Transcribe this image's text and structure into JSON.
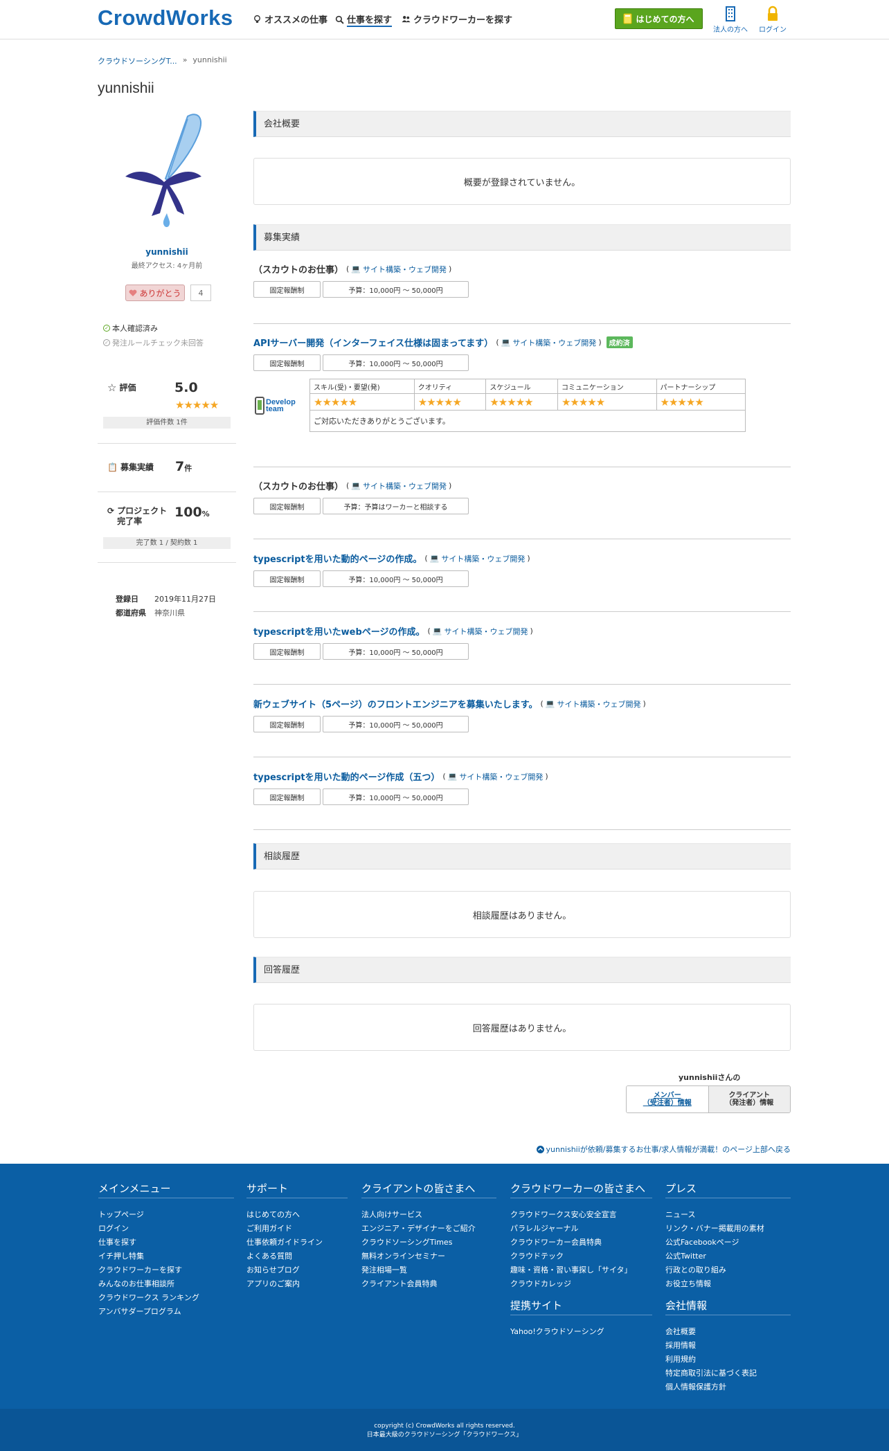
{
  "header": {
    "logo": "CrowdWorks",
    "nav": [
      {
        "label": "オススメの仕事"
      },
      {
        "label": "仕事を探す"
      },
      {
        "label": "クラウドワーカーを探す"
      }
    ],
    "start_button": "はじめての方へ",
    "corporate_label": "法人の方へ",
    "login_label": "ログイン"
  },
  "breadcrumb": {
    "root": "クラウドソーシングT...",
    "separator": "»",
    "current": "yunnishii"
  },
  "page_title": "yunnishii",
  "profile": {
    "name": "yunnishii",
    "last_access": "最終アクセス: 4ヶ月前",
    "thanks_label": "ありがとう",
    "thanks_count": "4",
    "verified": "本人確認済み",
    "rule_check": "発注ルールチェック未回答",
    "rating_label": "評価",
    "rating_value": "5.0",
    "rating_stars": "★★★★★",
    "rating_count": "評価件数 1件",
    "recruit_label": "募集実績",
    "recruit_value": "7",
    "recruit_unit": "件",
    "completion_label_1": "プロジェクト",
    "completion_label_2": "完了率",
    "completion_value": "100",
    "completion_unit": "%",
    "completion_sub": "完了数 1 / 契約数 1",
    "registered_label": "登録日",
    "registered_value": "2019年11月27日",
    "prefecture_label": "都道府県",
    "prefecture_value": "神奈川県"
  },
  "sections": {
    "overview": "会社概要",
    "overview_empty": "概要が登録されていません。",
    "recruit": "募集実績",
    "consult": "相談履歴",
    "consult_empty": "相談履歴はありません。",
    "answer": "回答履歴",
    "answer_empty": "回答履歴はありません。"
  },
  "jobs": [
    {
      "title": "（スカウトのお仕事）",
      "category": "サイト構築・ウェブ開発",
      "type": "固定報酬制",
      "budget": "予算：10,000円 〜 50,000円"
    },
    {
      "title": "APIサーバー開発（インターフェイス仕様は固まってます）",
      "category": "サイト構築・ウェブ開発",
      "badge": "成約済",
      "type": "固定報酬制",
      "budget": "予算：10,000円 〜 50,000円"
    },
    {
      "title": "（スカウトのお仕事）",
      "category": "サイト構築・ウェブ開発",
      "type": "固定報酬制",
      "budget": "予算：予算はワーカーと相談する"
    },
    {
      "title": "typescriptを用いた動的ページの作成。",
      "category": "サイト構築・ウェブ開発",
      "type": "固定報酬制",
      "budget": "予算：10,000円 〜 50,000円"
    },
    {
      "title": "typescriptを用いたwebページの作成。",
      "category": "サイト構築・ウェブ開発",
      "type": "固定報酬制",
      "budget": "予算：10,000円 〜 50,000円"
    },
    {
      "title": "新ウェブサイト（5ページ）のフロントエンジニアを募集いたします。",
      "category": "サイト構築・ウェブ開発",
      "type": "固定報酬制",
      "budget": "予算：10,000円 〜 50,000円"
    },
    {
      "title": "typescriptを用いた動的ページ作成（五つ）",
      "category": "サイト構築・ウェブ開発",
      "type": "固定報酬制",
      "budget": "予算：10,000円 〜 50,000円"
    }
  ],
  "review": {
    "logo_line1": "Develop",
    "logo_line2": "team",
    "headers": [
      "スキル(受)・要望(発)",
      "クオリティ",
      "スケジュール",
      "コミュニケーション",
      "パートナーシップ"
    ],
    "stars": "★★★★★",
    "comment": "ご対応いただきありがとうございます。"
  },
  "role": {
    "label": "yunnishiiさんの",
    "member_1": "メンバー",
    "member_2": "（受注者）情報",
    "client_1": "クライアント",
    "client_2": "（発注者）情報"
  },
  "back_top": "yunnishiiが依頼/募集するお仕事/求人情報が満載！のページ上部へ戻る",
  "footer": {
    "main_menu": {
      "title": "メインメニュー",
      "items": [
        "トップページ",
        "ログイン",
        "仕事を探す",
        "イチ押し特集",
        "クラウドワーカーを探す",
        "みんなのお仕事相談所",
        "クラウドワークス ランキング",
        "アンバサダープログラム"
      ]
    },
    "support": {
      "title": "サポート",
      "items": [
        "はじめての方へ",
        "ご利用ガイド",
        "仕事依頼ガイドライン",
        "よくある質問",
        "お知らせブログ",
        "アプリのご案内"
      ]
    },
    "clients": {
      "title": "クライアントの皆さまへ",
      "items": [
        "法人向けサービス",
        "エンジニア・デザイナーをご紹介",
        "クラウドソーシングTimes",
        "無料オンラインセミナー",
        "発注相場一覧",
        "クライアント会員特典"
      ]
    },
    "workers": {
      "title": "クラウドワーカーの皆さまへ",
      "items": [
        "クラウドワークス安心安全宣言",
        "パラレルジャーナル",
        "クラウドワーカー会員特典",
        "クラウドテック",
        "趣味・資格・習い事探し「サイタ」",
        "クラウドカレッジ"
      ]
    },
    "partner": {
      "title": "提携サイト",
      "items": [
        "Yahoo!クラウドソーシング"
      ]
    },
    "press": {
      "title": "プレス",
      "items": [
        "ニュース",
        "リンク・バナー掲載用の素材",
        "公式Facebookページ",
        "公式Twitter",
        "行政との取り組み",
        "お役立ち情報"
      ]
    },
    "company": {
      "title": "会社情報",
      "items": [
        "会社概要",
        "採用情報",
        "利用規約",
        "特定商取引法に基づく表記",
        "個人情報保護方針"
      ]
    },
    "copyright": "copyright (c) CrowdWorks all rights reserved.",
    "tagline": "日本最大級のクラウドソーシング「クラウドワークス」"
  },
  "colors": {
    "brand": "#1769b5",
    "link": "#0b5c9e",
    "start_button": "#5aa51e",
    "footer": "#0b5fa5",
    "stars": "#f5a623",
    "badge": "#5cb85c"
  }
}
